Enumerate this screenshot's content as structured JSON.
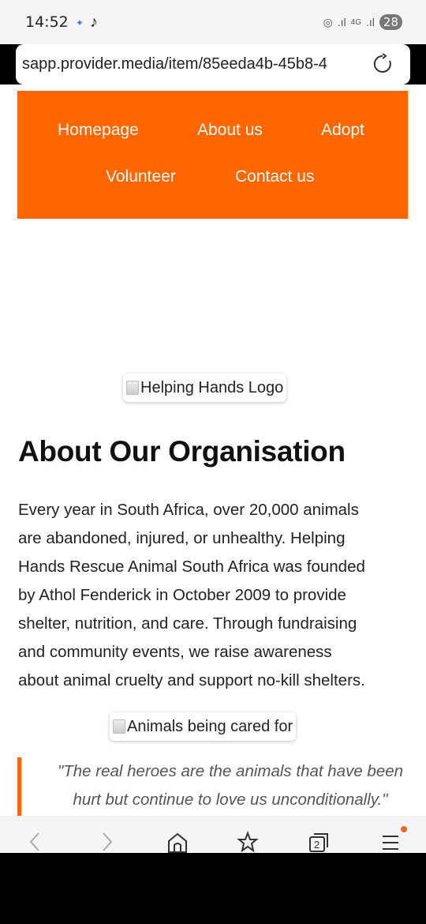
{
  "status": {
    "time": "14:52",
    "battery": "28",
    "network": "4G"
  },
  "browser": {
    "url": "sapp.provider.media/item/85eeda4b-45b8-4"
  },
  "nav": {
    "items": [
      "Homepage",
      "About us",
      "Adopt",
      "Volunteer",
      "Contact us"
    ]
  },
  "images": {
    "logo_alt": "Helping Hands Logo",
    "care_alt": "Animals being cared for"
  },
  "about": {
    "heading": "About Our Organisation",
    "paragraph_lines": [
      "Every year in South Africa, over 20,000 animals",
      "are abandoned, injured, or unhealthy. Helping",
      "Hands Rescue Animal South Africa was founded",
      "by Athol Fenderick in October 2009 to provide",
      "shelter, nutrition, and care. Through fundraising",
      "and community events, we raise awareness",
      "about animal cruelty and support no-kill shelters."
    ]
  },
  "quote": {
    "lines": [
      "\"The real heroes are the animals that have been",
      "hurt but continue to love us unconditionally.\""
    ]
  },
  "bottom_nav": {
    "tabs_count": "2"
  },
  "colors": {
    "accent": "#ff6600"
  }
}
